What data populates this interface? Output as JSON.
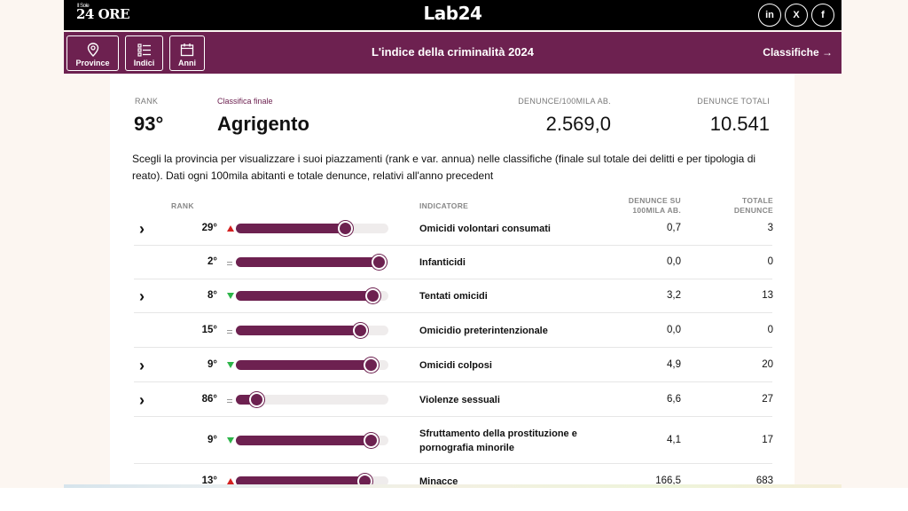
{
  "topbar": {
    "logo_left": "24 ORE",
    "logo_left_small": "Il Sole",
    "logo_center": "Lab24",
    "socials": [
      {
        "label": "in",
        "icon": "linkedin-icon"
      },
      {
        "label": "X",
        "icon": "x-icon"
      },
      {
        "label": "f",
        "icon": "facebook-icon"
      }
    ]
  },
  "navbar": {
    "buttons": [
      {
        "label": "Province",
        "icon": "location-pin-icon"
      },
      {
        "label": "Indici",
        "icon": "list-icon"
      },
      {
        "label": "Anni",
        "icon": "calendar-icon"
      }
    ],
    "title": "L'indice della criminalità 2024",
    "classifiche": "Classifiche →"
  },
  "summary": {
    "rank_label": "RANK",
    "rank_value": "93°",
    "classifica_label": "Classifica finale",
    "province": "Agrigento",
    "denunce_100k_label": "DENUNCE/100MILA AB.",
    "denunce_100k_value": "2.569,0",
    "denunce_totali_label": "DENUNCE TOTALI",
    "denunce_totali_value": "10.541"
  },
  "description": "Scegli la provincia per visualizzare i suoi piazzamenti (rank e var. annua) nelle classifiche (finale sul totale dei delitti e per tipologia di reato). Dati ogni 100mila abitanti e totale denunce, relativi all'anno precedent",
  "table": {
    "headers": {
      "rank": "RANK",
      "indicator": "INDICATORE",
      "denunce_100k_1": "DENUNCE SU",
      "denunce_100k_2": "100MILA AB.",
      "totale_1": "TOTALE",
      "totale_2": "DENUNCE"
    },
    "rows": [
      {
        "expandable": true,
        "rank": "29°",
        "trend": "up",
        "score": 0.72,
        "indicator": "Omicidi volontari consumati",
        "den": "0,7",
        "tot": "3"
      },
      {
        "expandable": false,
        "rank": "2°",
        "trend": "eq",
        "score": 0.94,
        "indicator": "Infanticidi",
        "den": "0,0",
        "tot": "0"
      },
      {
        "expandable": true,
        "rank": "8°",
        "trend": "down",
        "score": 0.9,
        "indicator": "Tentati omicidi",
        "den": "3,2",
        "tot": "13"
      },
      {
        "expandable": false,
        "rank": "15°",
        "trend": "eq",
        "score": 0.82,
        "indicator": "Omicidio preterintenzionale",
        "den": "0,0",
        "tot": "0"
      },
      {
        "expandable": true,
        "rank": "9°",
        "trend": "down",
        "score": 0.89,
        "indicator": "Omicidi colposi",
        "den": "4,9",
        "tot": "20"
      },
      {
        "expandable": true,
        "rank": "86°",
        "trend": "eq",
        "score": 0.14,
        "indicator": "Violenze sessuali",
        "den": "6,6",
        "tot": "27"
      },
      {
        "expandable": false,
        "rank": "9°",
        "trend": "down",
        "score": 0.89,
        "indicator": "Sfruttamento della prostituzione e pornografia minorile",
        "den": "4,1",
        "tot": "17"
      },
      {
        "expandable": false,
        "rank": "13°",
        "trend": "up",
        "score": 0.85,
        "indicator": "Minacce",
        "den": "166,5",
        "tot": "683"
      }
    ]
  },
  "colors": {
    "accent": "#6d2150",
    "up": "#d32020",
    "down": "#2eb54a"
  }
}
